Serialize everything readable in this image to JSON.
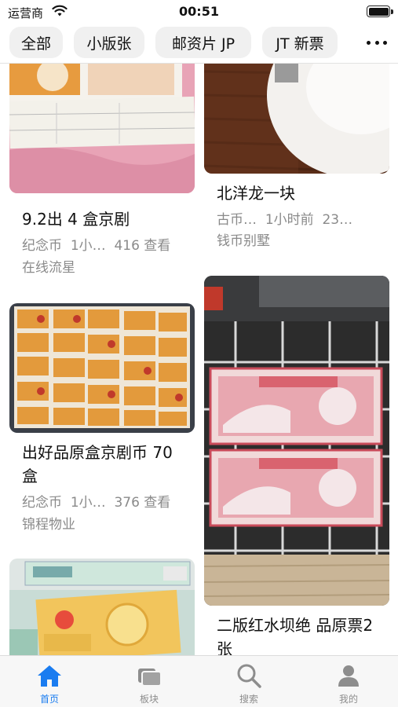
{
  "status_bar": {
    "carrier": "运营商",
    "time": "00:51"
  },
  "tabs": [
    "全部",
    "小版张",
    "邮资片 JP",
    "JT 新票"
  ],
  "colors": {
    "accent": "#1a7cf0",
    "inactive": "#8d8d8d",
    "meta": "#8a8a8a"
  },
  "icons": [
    "wifi-icon",
    "battery-icon",
    "more-icon",
    "home-icon",
    "board-icon",
    "search-icon",
    "profile-icon"
  ],
  "feed": {
    "left": [
      {
        "title": "9.2出 4 盒京剧",
        "category": "纪念币",
        "time": "1小…",
        "views": "416 查看",
        "author": "在线流星"
      },
      {
        "title": "出好品原盒京剧币 70盒",
        "category": "纪念币",
        "time": "1小…",
        "views": "376 查看",
        "author": "锦程物业"
      },
      {
        "title": "",
        "category": "",
        "time": "",
        "views": "",
        "author": ""
      }
    ],
    "right": [
      {
        "title": "北洋龙一块",
        "category": "古币…",
        "time": "1小时前",
        "views": "23…",
        "author": "钱币别墅"
      },
      {
        "title": "二版红水坝绝 品原票2张",
        "category": "",
        "time": "",
        "views": "",
        "author": ""
      }
    ]
  },
  "tabbar": [
    {
      "label": "首页",
      "icon": "home-icon",
      "active": true
    },
    {
      "label": "板块",
      "icon": "board-icon",
      "active": false
    },
    {
      "label": "搜索",
      "icon": "search-icon",
      "active": false
    },
    {
      "label": "我的",
      "icon": "profile-icon",
      "active": false
    }
  ]
}
